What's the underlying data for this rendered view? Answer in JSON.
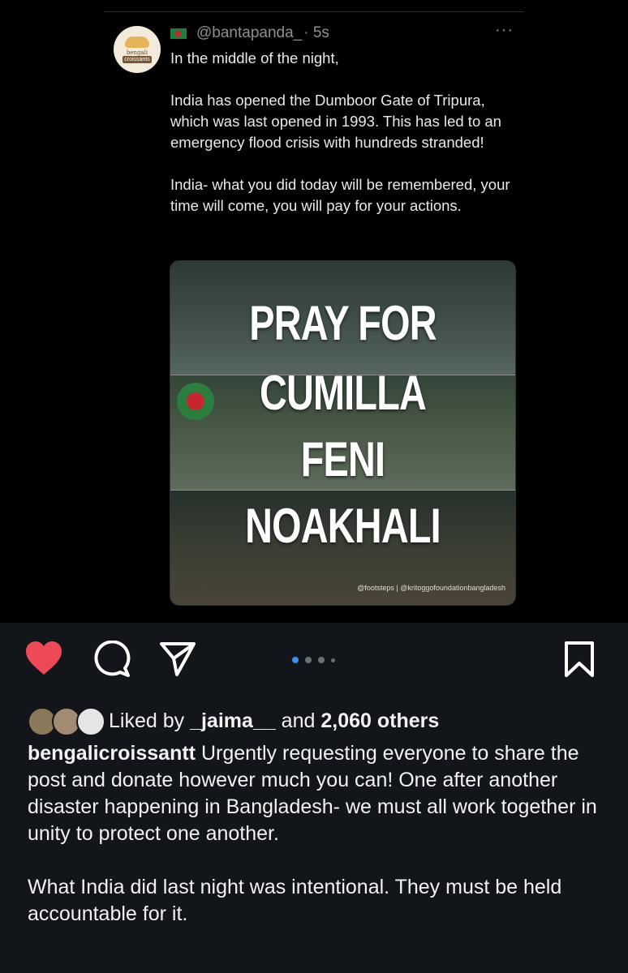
{
  "tweet": {
    "handle": "@bantapanda_",
    "time": "· 5s",
    "more_label": "···",
    "avatar_text": [
      "bengali",
      "croissants"
    ],
    "paragraphs": [
      "In the middle of the night,",
      "India has opened the Dumboor Gate of Tripura, which was last opened in 1993. This has led to an emergency flood crisis with hundreds stranded!",
      "India- what you did today will be remembered, your time will come, you will pay for your actions."
    ],
    "image": {
      "lines": [
        "PRAY FOR",
        "CUMILLA",
        "FENI",
        "NOAKHALI"
      ],
      "credit": "@footsteps | @kritoggofoundationbangladesh"
    }
  },
  "actions": {
    "like": "heart-icon",
    "comment": "comment-icon",
    "share": "send-icon",
    "save": "bookmark-icon",
    "like_color": "#ed4956",
    "carousel_active_color": "#3a8ef6"
  },
  "carousel": {
    "count": 4,
    "active": 0
  },
  "likes": {
    "prefix": "Liked by",
    "user": "_jaima__",
    "middle": "and",
    "others": "2,060 others"
  },
  "caption": {
    "username": "bengalicroissantt",
    "text": "Urgently requesting everyone to share the post and donate however much you can! One after another disaster happening in Bangladesh- we must all work together in unity to protect one another.",
    "text2": "What India did last night was intentional. They must be held accountable for it."
  }
}
